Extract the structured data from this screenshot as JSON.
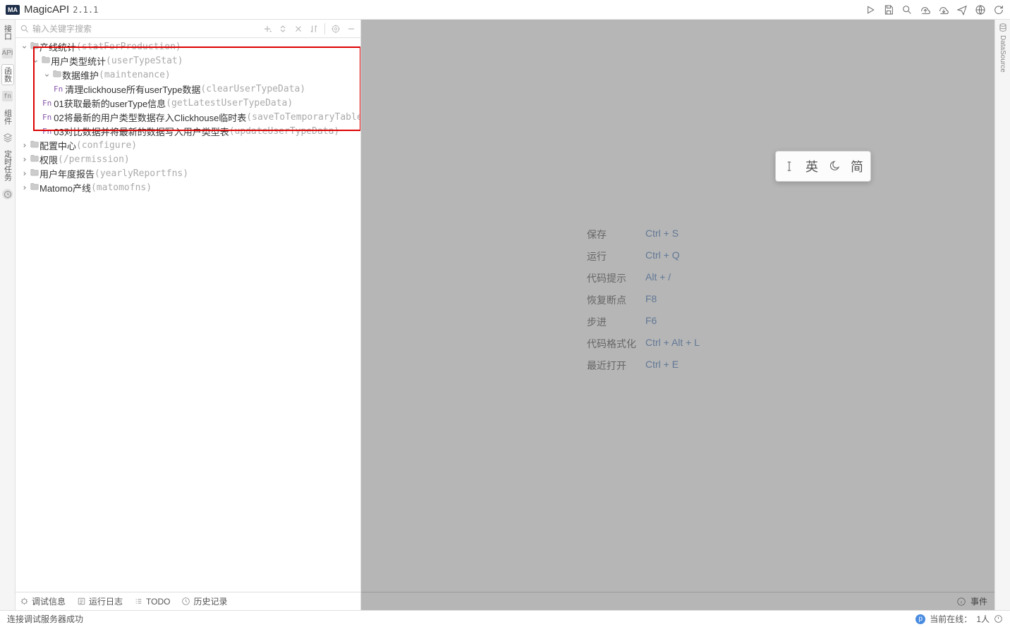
{
  "app": {
    "name": "MagicAPI",
    "version": "2.1.1"
  },
  "search": {
    "placeholder": "输入关键字搜索"
  },
  "leftRail": {
    "api": "接口",
    "fn": "函数",
    "component": "组件",
    "task": "定时任务"
  },
  "tree": [
    {
      "indent": 0,
      "type": "folder",
      "open": "down",
      "label": "产线统计",
      "alias": "(statForProduction)"
    },
    {
      "indent": 1,
      "type": "folder",
      "open": "down",
      "label": "用户类型统计",
      "alias": "(userTypeStat)"
    },
    {
      "indent": 2,
      "type": "folder",
      "open": "down",
      "label": "数据维护",
      "alias": "(maintenance)"
    },
    {
      "indent": 3,
      "type": "fn",
      "label": "清理clickhouse所有userType数据",
      "alias": "(clearUserTypeData)"
    },
    {
      "indent": 2,
      "type": "fn",
      "label": "01获取最新的userType信息",
      "alias": "(getLatestUserTypeData)"
    },
    {
      "indent": 2,
      "type": "fn",
      "label": "02将最新的用户类型数据存入Clickhouse临时表",
      "alias": "(saveToTemporaryTable)"
    },
    {
      "indent": 2,
      "type": "fn",
      "label": "03对比数据并将最新的数据写入用户类型表",
      "alias": "(updateUserTypeData)"
    },
    {
      "indent": 0,
      "type": "folder",
      "open": "right",
      "label": "配置中心",
      "alias": "(configure)"
    },
    {
      "indent": 0,
      "type": "folder",
      "open": "right",
      "label": "权限",
      "alias": "(/permission)"
    },
    {
      "indent": 0,
      "type": "folder",
      "open": "right",
      "label": "用户年度报告",
      "alias": "(yearlyReportfns)"
    },
    {
      "indent": 0,
      "type": "folder",
      "open": "right",
      "label": "Matomo产线",
      "alias": "(matomofns)"
    }
  ],
  "bottomTabs": {
    "debug": "调试信息",
    "log": "运行日志",
    "todo": "TODO",
    "history": "历史记录",
    "event": "事件"
  },
  "shortcuts": [
    {
      "label": "保存",
      "key": "Ctrl + S"
    },
    {
      "label": "运行",
      "key": "Ctrl + Q"
    },
    {
      "label": "代码提示",
      "key": "Alt + /"
    },
    {
      "label": "恢复断点",
      "key": "F8"
    },
    {
      "label": "步进",
      "key": "F6"
    },
    {
      "label": "代码格式化",
      "key": "Ctrl + Alt + L"
    },
    {
      "label": "最近打开",
      "key": "Ctrl + E"
    }
  ],
  "ime": {
    "lang": "英",
    "shape": "简"
  },
  "rightRail": {
    "label": "DataSource"
  },
  "footer": {
    "left": "连接调试服务器成功",
    "onlineLabel": "当前在线：",
    "onlineCount": "1人"
  }
}
